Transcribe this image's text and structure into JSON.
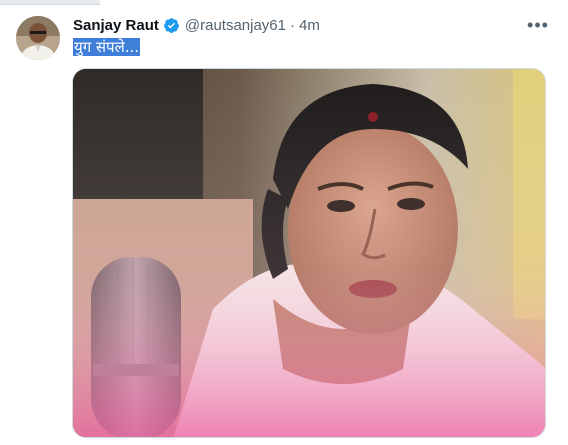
{
  "tweet": {
    "display_name": "Sanjay Raut",
    "handle": "@rautsanjay61",
    "separator": "·",
    "timestamp": "4m",
    "text": "युग संपले...",
    "verified_icon": "verified-badge-icon",
    "more_icon": "more-options-icon"
  },
  "colors": {
    "accent": "#1d9bf0",
    "selection": "#3f7fd9",
    "secondary_text": "#536471"
  }
}
